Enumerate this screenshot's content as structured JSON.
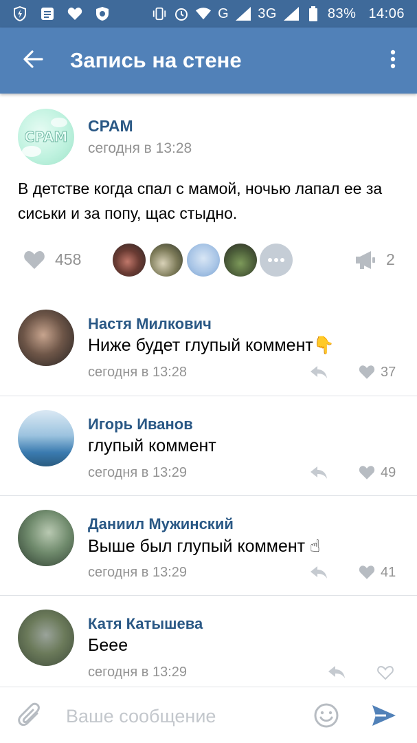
{
  "status_bar": {
    "network": "G",
    "network2": "3G",
    "battery": "83%",
    "time": "14:06"
  },
  "toolbar": {
    "title": "Запись на стене",
    "back_icon": "arrow-left-icon",
    "menu_icon": "more-vertical-icon"
  },
  "post": {
    "author": "СРАМ",
    "time": "сегодня в 13:28",
    "text": "В детстве когда спал с мамой, ночью лапал ее за сиськи и за попу, щас стыдно.",
    "likes": "458",
    "shares": "2"
  },
  "comments": [
    {
      "author": "Настя Милкович",
      "text": "Ниже будет глупый коммент👇",
      "time": "сегодня в 13:28",
      "likes": "37"
    },
    {
      "author": "Игорь Иванов",
      "text": "глупый коммент",
      "time": "сегодня в 13:29",
      "likes": "49"
    },
    {
      "author": "Даниил Мужинский",
      "text": "Выше был глупый коммент ☝",
      "time": "сегодня в 13:29",
      "likes": "41"
    },
    {
      "author": "Катя Катышева",
      "text": "Бeee",
      "time": "сегодня в 13:29",
      "likes": ""
    }
  ],
  "composer": {
    "placeholder": "Ваше сообщение"
  },
  "colors": {
    "toolbar": "#5181b8",
    "statusbar": "#3f6a9a",
    "link": "#2a5885",
    "muted": "#939393"
  }
}
